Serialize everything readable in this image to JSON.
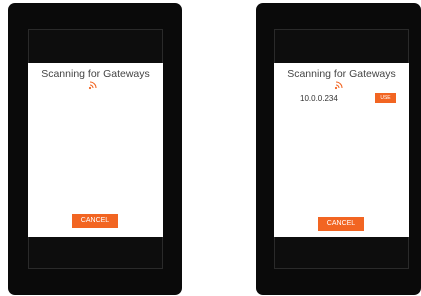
{
  "colors": {
    "accent": "#f26522",
    "device": "#0a0a0a",
    "screen": "#ffffff"
  },
  "screens": [
    {
      "title": "Scanning for Gateways",
      "status_icon": "wifi-scanning-icon",
      "gateways": [],
      "cancel_label": "CANCEL"
    },
    {
      "title": "Scanning for Gateways",
      "status_icon": "wifi-scanning-icon",
      "gateways": [
        {
          "ip": "10.0.0.234",
          "use_label": "USE"
        }
      ],
      "cancel_label": "CANCEL"
    }
  ]
}
